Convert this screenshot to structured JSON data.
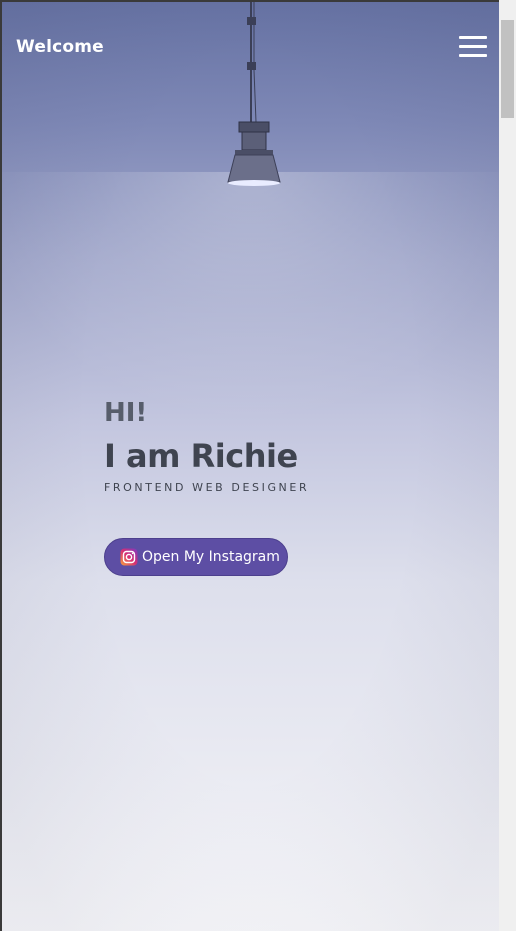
{
  "header": {
    "brand": "Welcome",
    "menu_icon": "hamburger-menu-icon"
  },
  "hero": {
    "greeting": "HI!",
    "name": "I am Richie",
    "role": "FRONTEND WEB DESIGNER"
  },
  "cta": {
    "label": "Open My Instagram",
    "icon": "instagram-icon"
  },
  "decor": {
    "lamp_icon": "hanging-lamp-icon"
  },
  "colors": {
    "background_top": "#6672a3",
    "background_bottom": "#f7f7fa",
    "button": "#5d4ea4",
    "heading": "#3f4450",
    "nav_text": "#ffffff"
  }
}
